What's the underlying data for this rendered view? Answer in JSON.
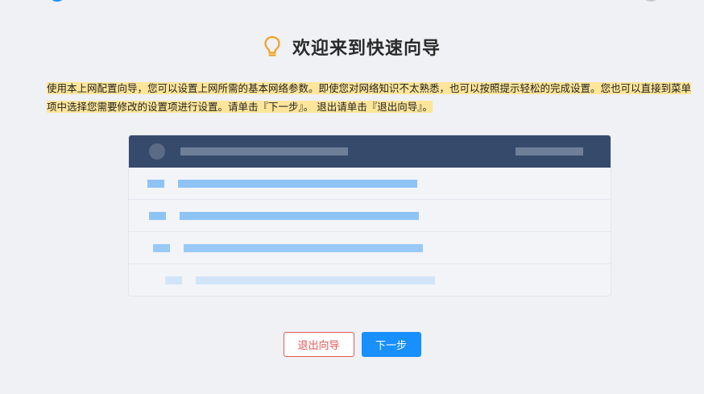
{
  "wizard": {
    "title": "欢迎来到快速向导",
    "intro_text": "使用本上网配置向导，您可以设置上网所需的基本网络参数。即使您对网络知识不太熟悉，也可以按照提示轻松的完成设置。您也可以直接到菜单项中选择您需要修改的设置项进行设置。请单击『下一步』。 退出请单击『退出向导』。",
    "icon": "lightbulb-icon",
    "accent_color": "#f0a020",
    "highlight_color": "#fde59a"
  },
  "buttons": {
    "exit_label": "退出向导",
    "next_label": "下一步",
    "exit_color": "#e0595a",
    "next_color": "#1890ff"
  },
  "illustration": {
    "icon": "settings-list-illustration",
    "header_color": "#364a6b",
    "row_color": "#8ec3f5",
    "row_count": 4
  },
  "stepper": {
    "active_color": "#1890ff",
    "inactive_color": "#c8c8c8"
  }
}
